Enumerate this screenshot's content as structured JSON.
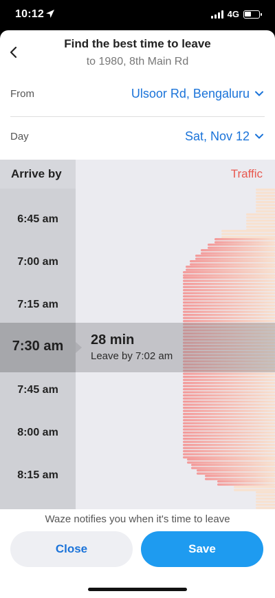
{
  "status_bar": {
    "time": "10:12",
    "network": "4G",
    "battery_level": 0.45
  },
  "header": {
    "title": "Find the best time to leave",
    "subtitle": "to 1980, 8th Main Rd",
    "back_icon": "chevron-left-icon"
  },
  "from": {
    "label": "From",
    "value": "Ulsoor Rd, Bengaluru",
    "icon": "chevron-down-icon"
  },
  "day": {
    "label": "Day",
    "value": "Sat, Nov 12",
    "icon": "chevron-down-icon"
  },
  "schedule": {
    "arrive_label": "Arrive by",
    "traffic_label": "Traffic",
    "slots": [
      "6:45 am",
      "7:00 am",
      "7:15 am",
      "7:30 am",
      "7:45 am",
      "8:00 am",
      "8:15 am"
    ],
    "selected": {
      "time": "7:30 am",
      "duration": "28 min",
      "leave_by": "Leave by 7:02 am"
    }
  },
  "footer": {
    "notice": "Waze notifies you when it's time to leave",
    "close_label": "Close",
    "save_label": "Save"
  },
  "colors": {
    "accent": "#1a73d9",
    "save": "#1e9bf0",
    "traffic": "#e8584f",
    "traffic_light": "#f8e1cf",
    "traffic_heavy": "#f39a9a"
  }
}
